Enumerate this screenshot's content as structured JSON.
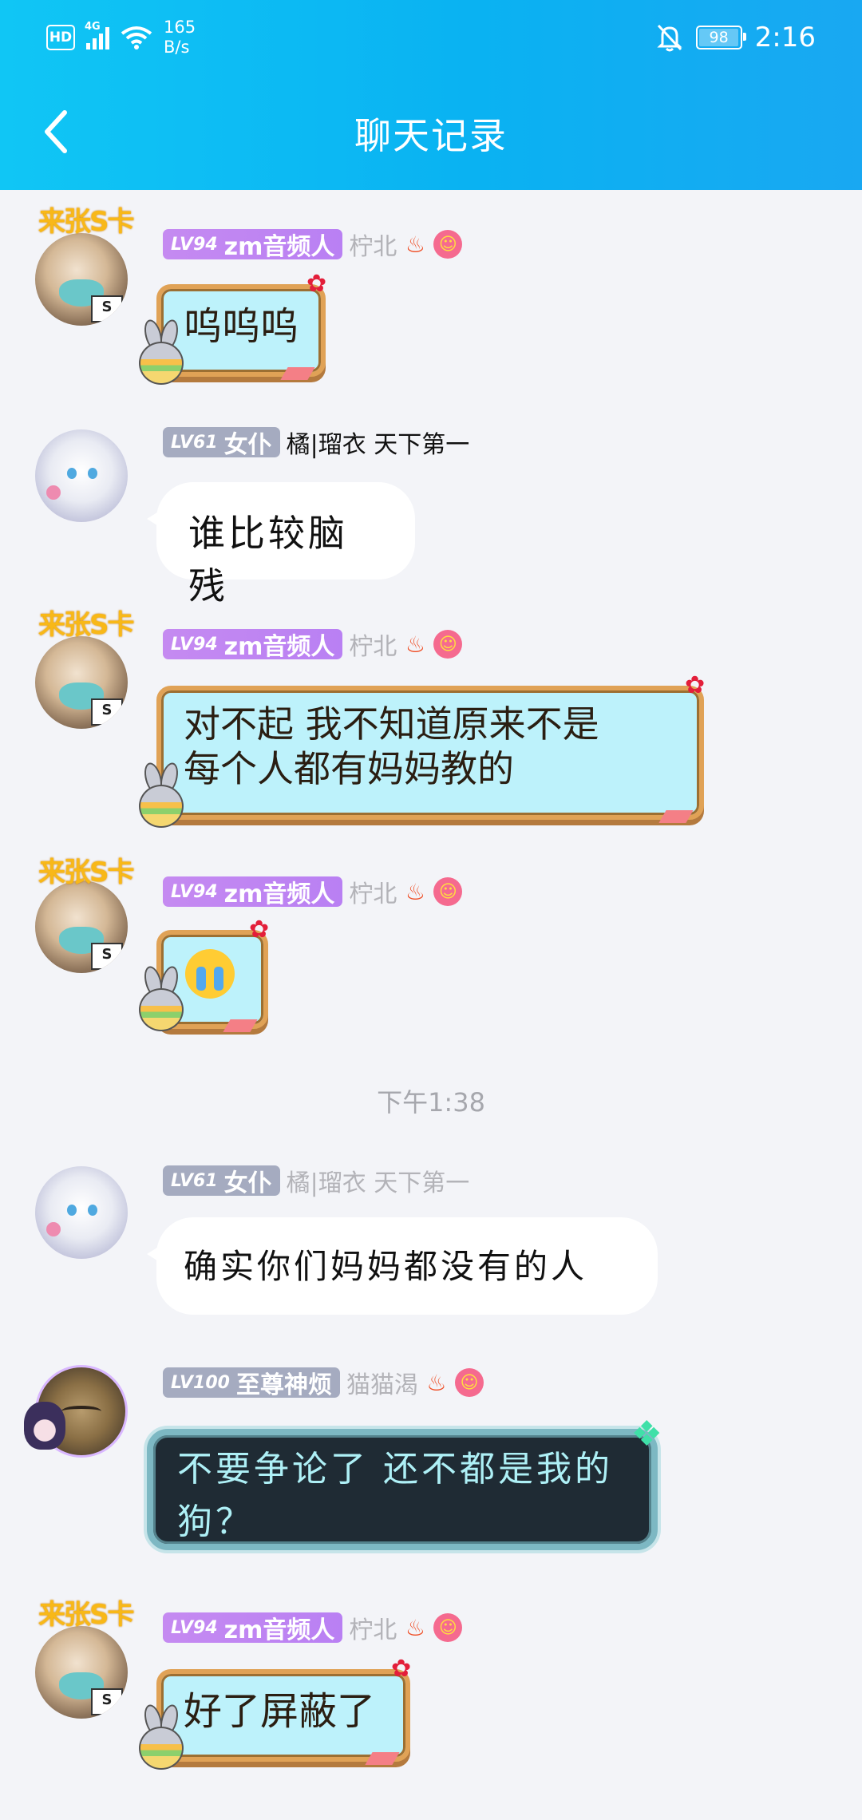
{
  "status_bar": {
    "hd": "HD",
    "network": "4G",
    "speed_value": "165",
    "speed_unit": "B/s",
    "battery": "98",
    "time": "2:16"
  },
  "header": {
    "title": "聊天记录"
  },
  "messages": [
    {
      "frame_text": "来张S卡",
      "level": "LV94",
      "title": "zm音频人",
      "nickname": "柠北",
      "text": "呜呜呜"
    },
    {
      "level": "LV61",
      "title": "女仆",
      "nickname": "橘|瑠衣 天下第一",
      "text": "谁比较脑残"
    },
    {
      "frame_text": "来张S卡",
      "level": "LV94",
      "title": "zm音频人",
      "nickname": "柠北",
      "line1": "对不起 我不知道原来不是",
      "line2": "每个人都有妈妈教的"
    },
    {
      "frame_text": "来张S卡",
      "level": "LV94",
      "title": "zm音频人",
      "nickname": "柠北",
      "sticker": "crying-emoji"
    },
    {
      "level": "LV61",
      "title": "女仆",
      "nickname": "橘|瑠衣 天下第一",
      "text": "确实你们妈妈都没有的人"
    },
    {
      "level": "LV100",
      "title": "至尊神烦",
      "nickname": "猫猫渴",
      "line1": "不要争论了 还不都是我的",
      "line2": "狗？"
    },
    {
      "frame_text": "来张S卡",
      "level": "LV94",
      "title": "zm音频人",
      "nickname": "柠北",
      "text": "好了屏蔽了"
    }
  ],
  "time_divider": "下午1:38"
}
